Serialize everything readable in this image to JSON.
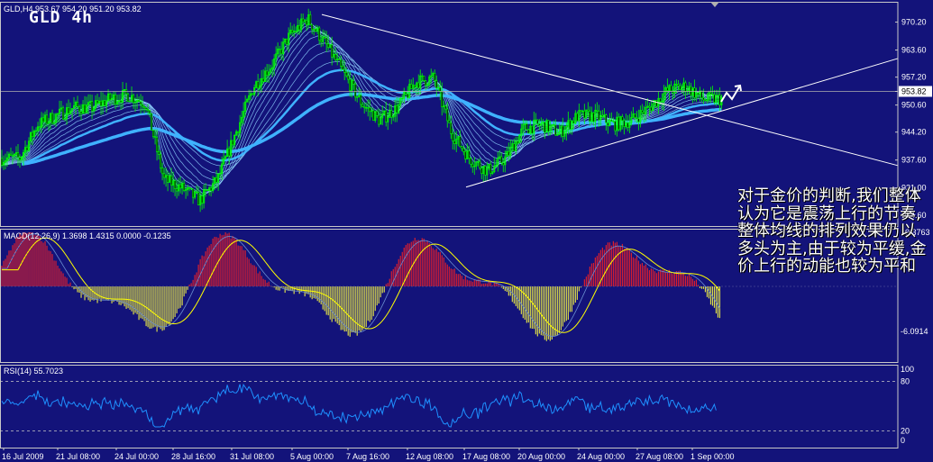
{
  "symbol_label": "GLD 4h",
  "main_header": "GLD,H4  953.67 954.20 951.20 953.82",
  "macd_header": "MACD(12,26,9) 1.3698 1.4315 0.0000 -0.1235",
  "rsi_header": "RSI(14) 55.7023",
  "commentary": "对于金价的判断,我们整体认为它是震荡上行的节奏,整体均线的排列效果仍以多头为主,由于较为平缓,金价上行的动能也较为平和",
  "colors": {
    "background": "#13137a",
    "up_candle": "#00ff00",
    "ma_main": "#3fb2ff",
    "ma_thin": "#8fd4ff",
    "trendline": "#ffffff",
    "macd_pos": "#ff2020",
    "macd_neg": "#ffff40",
    "signal": "#ffff00",
    "rsi_line": "#1e90ff",
    "grid": "#c8c8c8"
  },
  "chart_data": [
    {
      "type": "candlestick",
      "name": "GLD,H4",
      "price_axis_ticks": [
        "970.20",
        "963.60",
        "957.20",
        "953.82",
        "950.60",
        "944.20",
        "937.60",
        "931.00",
        "924.60"
      ],
      "current_price": 953.82,
      "ylim": [
        922,
        975
      ],
      "x_ticks": [
        "16 Jul 2009",
        "21 Jul 08:00",
        "24 Jul 00:00",
        "28 Jul 16:00",
        "31 Jul 08:00",
        "5 Aug 00:00",
        "7 Aug 16:00",
        "12 Aug 08:00",
        "17 Aug 08:00",
        "20 Aug 00:00",
        "24 Aug 00:00",
        "27 Aug 08:00",
        "1 Sep 00:00"
      ],
      "price_path": [
        [
          0,
          938
        ],
        [
          2,
          938
        ],
        [
          4,
          946
        ],
        [
          6,
          948
        ],
        [
          8,
          950
        ],
        [
          10,
          950
        ],
        [
          12,
          952
        ],
        [
          14,
          953
        ],
        [
          16,
          951
        ],
        [
          18,
          933
        ],
        [
          20,
          931
        ],
        [
          22,
          928
        ],
        [
          24,
          933
        ],
        [
          26,
          944
        ],
        [
          28,
          955
        ],
        [
          30,
          960
        ],
        [
          32,
          967
        ],
        [
          34,
          971
        ],
        [
          36,
          965
        ],
        [
          38,
          958
        ],
        [
          40,
          951
        ],
        [
          42,
          947
        ],
        [
          44,
          950
        ],
        [
          46,
          956
        ],
        [
          48,
          957
        ],
        [
          50,
          944
        ],
        [
          52,
          938
        ],
        [
          54,
          935
        ],
        [
          56,
          938
        ],
        [
          58,
          945
        ],
        [
          60,
          946
        ],
        [
          62,
          944
        ],
        [
          64,
          948
        ],
        [
          66,
          948
        ],
        [
          68,
          946
        ],
        [
          70,
          947
        ],
        [
          72,
          950
        ],
        [
          74,
          954
        ],
        [
          76,
          955
        ],
        [
          78,
          952
        ],
        [
          80,
          952
        ]
      ],
      "moving_averages": [
        "thin ribbon MAs",
        "thick MA (light blue)"
      ],
      "trendlines": [
        {
          "from": [
            "5 Aug 00:00",
            972
          ],
          "to": [
            "end",
            936
          ]
        },
        {
          "from": [
            "17 Aug 08:00",
            931
          ],
          "to": [
            "end",
            960
          ]
        }
      ]
    },
    {
      "type": "bar",
      "name": "MACD(12,26,9)",
      "values_text": [
        "1.3698",
        "1.4315",
        "0.0000",
        "-0.1235"
      ],
      "axis_ticks": [
        "10.3763",
        "-6.0914"
      ],
      "zero_line": 0
    },
    {
      "type": "line",
      "name": "RSI(14)",
      "current_value": 55.7023,
      "axis_ticks": [
        "100",
        "80",
        "20",
        "0"
      ],
      "levels": [
        80,
        20
      ],
      "ylim": [
        0,
        100
      ]
    }
  ]
}
